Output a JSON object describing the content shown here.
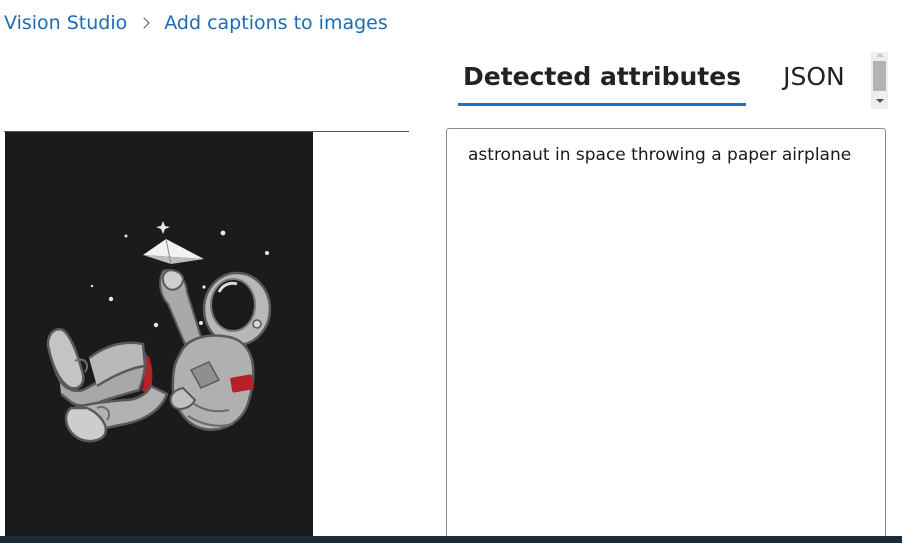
{
  "breadcrumb": {
    "root": "Vision Studio",
    "current": "Add captions to images"
  },
  "tabs": [
    {
      "label": "Detected attributes",
      "active": true
    },
    {
      "label": "JSON",
      "active": false
    }
  ],
  "result": {
    "caption": "astronaut in space throwing a paper airplane"
  },
  "image": {
    "alt": "astronaut in space throwing a paper airplane"
  },
  "colors": {
    "accent": "#1a73c9",
    "link": "#1c6bb5",
    "image_background": "#1b1b1d"
  }
}
